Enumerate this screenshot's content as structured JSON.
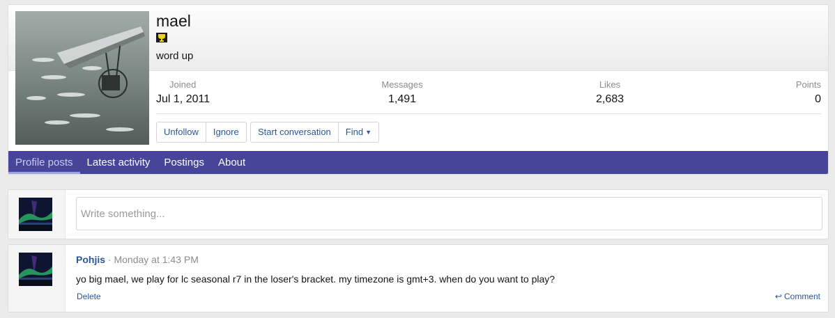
{
  "profile": {
    "username": "mael",
    "title": "word up",
    "avatar_icon": "microlight-aircraft-with-birds-photo",
    "trophy_icon": "trophy-icon",
    "stats": {
      "joined_label": "Joined",
      "joined_value": "Jul 1, 2011",
      "messages_label": "Messages",
      "messages_value": "1,491",
      "likes_label": "Likes",
      "likes_value": "2,683",
      "points_label": "Points",
      "points_value": "0"
    },
    "buttons": {
      "unfollow": "Unfollow",
      "ignore": "Ignore",
      "start_conversation": "Start conversation",
      "find": "Find"
    },
    "tabs": [
      {
        "label": "Profile posts",
        "active": true
      },
      {
        "label": "Latest activity",
        "active": false
      },
      {
        "label": "Postings",
        "active": false
      },
      {
        "label": "About",
        "active": false
      }
    ]
  },
  "composer": {
    "placeholder": "Write something...",
    "avatar_icon": "aurora-photo"
  },
  "post": {
    "author": "Pohjis",
    "separator": "·",
    "time": "Monday at 1:43 PM",
    "body": "yo big mael, we play for lc seasonal r7 in the loser's bracket. my timezone is gmt+3. when do you want to play?",
    "delete_label": "Delete",
    "comment_label": "Comment",
    "avatar_icon": "aurora-photo"
  },
  "colors": {
    "accent": "#46459a",
    "link": "#2b5797",
    "muted": "#8c8c8c",
    "page_bg": "#ebebeb"
  }
}
